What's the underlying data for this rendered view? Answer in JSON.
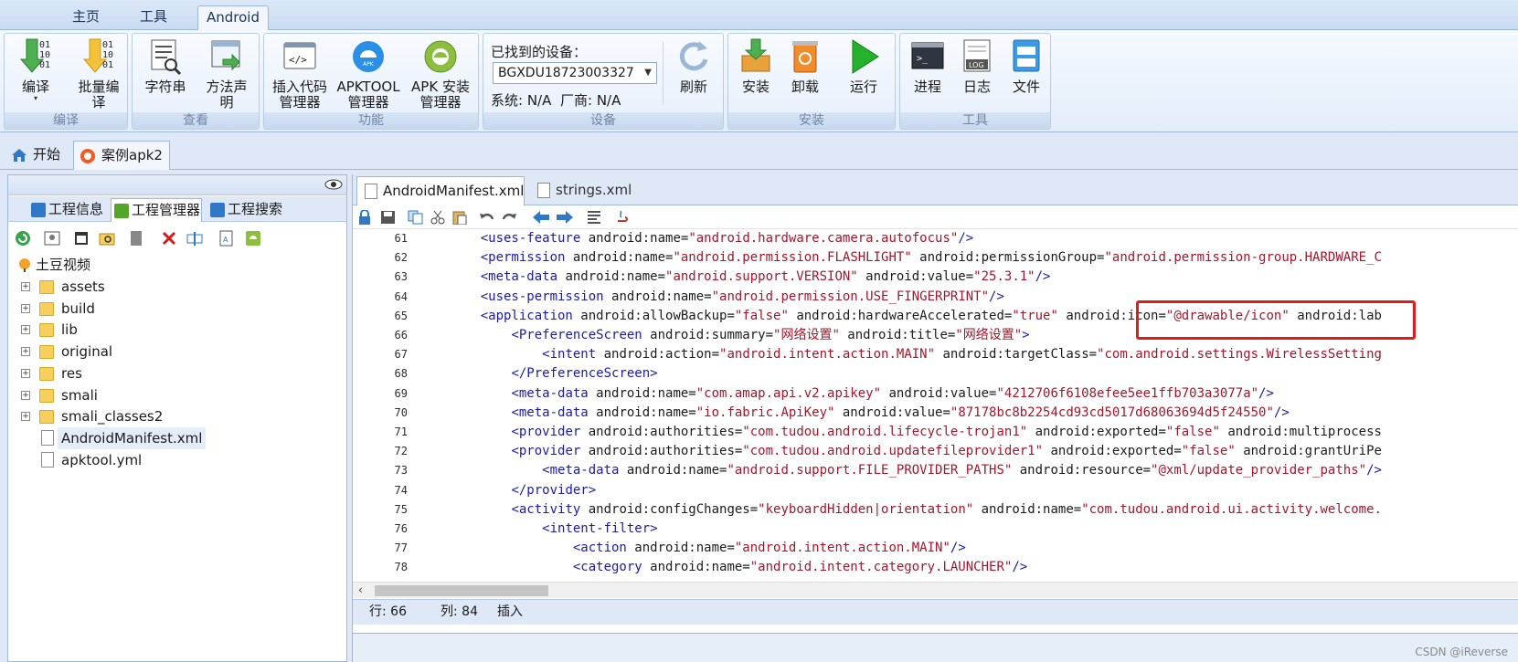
{
  "menu": {
    "tabs": [
      "主页",
      "工具",
      "Android"
    ],
    "active": "Android"
  },
  "ribbon": {
    "groups": [
      {
        "caption": "编译",
        "buttons": [
          "编译",
          "批量编\n译"
        ]
      },
      {
        "caption": "查看",
        "buttons": [
          "字符串",
          "方法声\n明"
        ]
      },
      {
        "caption": "功能",
        "buttons": [
          "插入代码\n管理器",
          "APKTOOL\n管理器",
          "APK 安装\n管理器"
        ]
      },
      {
        "caption": "设备",
        "buttons": [
          "刷新"
        ]
      },
      {
        "caption": "安装",
        "buttons": [
          "安装",
          "卸载",
          "运行"
        ]
      },
      {
        "caption": "工具",
        "buttons": [
          "进程",
          "日志",
          "文件"
        ]
      }
    ],
    "device": {
      "found_label": "已找到的设备：",
      "selected": "BGXDU18723003327",
      "system": "系统: N/A",
      "vendor": "厂商: N/A"
    }
  },
  "doc_tabs": [
    "开始",
    "案例apk2"
  ],
  "left_panel": {
    "tabs": [
      "工程信息",
      "工程管理器",
      "工程搜索"
    ],
    "tree": {
      "root": "土豆视频",
      "folders": [
        "assets",
        "build",
        "lib",
        "original",
        "res",
        "smali",
        "smali_classes2"
      ],
      "files": [
        "AndroidManifest.xml",
        "apktool.yml"
      ]
    }
  },
  "editor": {
    "tabs": [
      "AndroidManifest.xml",
      "strings.xml"
    ],
    "lines": [
      {
        "n": "61",
        "indent": "    ",
        "parts": [
          [
            "t",
            "<uses-feature "
          ],
          [
            "a",
            "android:name="
          ],
          [
            "v",
            "\"android.hardware.camera.autofocus\""
          ],
          [
            "t",
            "/>"
          ]
        ]
      },
      {
        "n": "62",
        "indent": "    ",
        "parts": [
          [
            "t",
            "<permission "
          ],
          [
            "a",
            "android:name="
          ],
          [
            "v",
            "\"android.permission.FLASHLIGHT\""
          ],
          [
            "a",
            " android:permissionGroup="
          ],
          [
            "v",
            "\"android.permission-group.HARDWARE_C"
          ]
        ]
      },
      {
        "n": "63",
        "indent": "    ",
        "parts": [
          [
            "t",
            "<meta-data "
          ],
          [
            "a",
            "android:name="
          ],
          [
            "v",
            "\"android.support.VERSION\""
          ],
          [
            "a",
            " android:value="
          ],
          [
            "v",
            "\"25.3.1\""
          ],
          [
            "t",
            "/>"
          ]
        ]
      },
      {
        "n": "64",
        "indent": "    ",
        "parts": [
          [
            "t",
            "<uses-permission "
          ],
          [
            "a",
            "android:name="
          ],
          [
            "v",
            "\"android.permission.USE_FINGERPRINT\""
          ],
          [
            "t",
            "/>"
          ]
        ]
      },
      {
        "n": "65",
        "indent": "    ",
        "parts": [
          [
            "t",
            "<application "
          ],
          [
            "a",
            "android:allowBackup="
          ],
          [
            "v",
            "\"false\""
          ],
          [
            "a",
            " android:hardwareAccelerated="
          ],
          [
            "v",
            "\"true\""
          ],
          [
            "a",
            " android:icon="
          ],
          [
            "v",
            "\"@drawable/icon\""
          ],
          [
            "a",
            " android:lab"
          ]
        ]
      },
      {
        "n": "66",
        "indent": "        ",
        "parts": [
          [
            "t",
            "<PreferenceScreen "
          ],
          [
            "a",
            "android:summary="
          ],
          [
            "v",
            "\"网络设置\""
          ],
          [
            "a",
            " android:title="
          ],
          [
            "v",
            "\"网络设置\""
          ],
          [
            "t",
            ">"
          ]
        ]
      },
      {
        "n": "67",
        "indent": "            ",
        "parts": [
          [
            "t",
            "<intent "
          ],
          [
            "a",
            "android:action="
          ],
          [
            "v",
            "\"android.intent.action.MAIN\""
          ],
          [
            "a",
            " android:targetClass="
          ],
          [
            "v",
            "\"com.android.settings.WirelessSetting"
          ]
        ]
      },
      {
        "n": "68",
        "indent": "        ",
        "parts": [
          [
            "t",
            "</PreferenceScreen>"
          ]
        ]
      },
      {
        "n": "69",
        "indent": "        ",
        "parts": [
          [
            "t",
            "<meta-data "
          ],
          [
            "a",
            "android:name="
          ],
          [
            "v",
            "\"com.amap.api.v2.apikey\""
          ],
          [
            "a",
            " android:value="
          ],
          [
            "v",
            "\"4212706f6108efee5ee1ffb703a3077a\""
          ],
          [
            "t",
            "/>"
          ]
        ]
      },
      {
        "n": "70",
        "indent": "        ",
        "parts": [
          [
            "t",
            "<meta-data "
          ],
          [
            "a",
            "android:name="
          ],
          [
            "v",
            "\"io.fabric.ApiKey\""
          ],
          [
            "a",
            " android:value="
          ],
          [
            "v",
            "\"87178bc8b2254cd93cd5017d68063694d5f24550\""
          ],
          [
            "t",
            "/>"
          ]
        ]
      },
      {
        "n": "71",
        "indent": "        ",
        "parts": [
          [
            "t",
            "<provider "
          ],
          [
            "a",
            "android:authorities="
          ],
          [
            "v",
            "\"com.tudou.android.lifecycle-trojan1\""
          ],
          [
            "a",
            " android:exported="
          ],
          [
            "v",
            "\"false\""
          ],
          [
            "a",
            " android:multiprocess"
          ]
        ]
      },
      {
        "n": "72",
        "indent": "        ",
        "parts": [
          [
            "t",
            "<provider "
          ],
          [
            "a",
            "android:authorities="
          ],
          [
            "v",
            "\"com.tudou.android.updatefileprovider1\""
          ],
          [
            "a",
            " android:exported="
          ],
          [
            "v",
            "\"false\""
          ],
          [
            "a",
            " android:grantUriPe"
          ]
        ]
      },
      {
        "n": "73",
        "indent": "            ",
        "parts": [
          [
            "t",
            "<meta-data "
          ],
          [
            "a",
            "android:name="
          ],
          [
            "v",
            "\"android.support.FILE_PROVIDER_PATHS\""
          ],
          [
            "a",
            " android:resource="
          ],
          [
            "v",
            "\"@xml/update_provider_paths\""
          ],
          [
            "t",
            "/>"
          ]
        ]
      },
      {
        "n": "74",
        "indent": "        ",
        "parts": [
          [
            "t",
            "</provider>"
          ]
        ]
      },
      {
        "n": "75",
        "indent": "        ",
        "parts": [
          [
            "t",
            "<activity "
          ],
          [
            "a",
            "android:configChanges="
          ],
          [
            "v",
            "\"keyboardHidden|orientation\""
          ],
          [
            "a",
            " android:name="
          ],
          [
            "v",
            "\"com.tudou.android.ui.activity.welcome."
          ]
        ]
      },
      {
        "n": "76",
        "indent": "            ",
        "parts": [
          [
            "t",
            "<intent-filter>"
          ]
        ]
      },
      {
        "n": "77",
        "indent": "                ",
        "parts": [
          [
            "t",
            "<action "
          ],
          [
            "a",
            "android:name="
          ],
          [
            "v",
            "\"android.intent.action.MAIN\""
          ],
          [
            "t",
            "/>"
          ]
        ]
      },
      {
        "n": "78",
        "indent": "                ",
        "parts": [
          [
            "t",
            "<category "
          ],
          [
            "a",
            "android:name="
          ],
          [
            "v",
            "\"android.intent.category.LAUNCHER\""
          ],
          [
            "t",
            "/>"
          ]
        ]
      }
    ]
  },
  "status": {
    "row": "行: 66",
    "col": "列: 84",
    "mode": "插入"
  },
  "watermark": "CSDN @iReverse",
  "colors": {
    "tag": "#1a1ab0",
    "value": "#a3162b",
    "highlight_box": "#e01b1b",
    "accent": "#3d7fd4"
  }
}
